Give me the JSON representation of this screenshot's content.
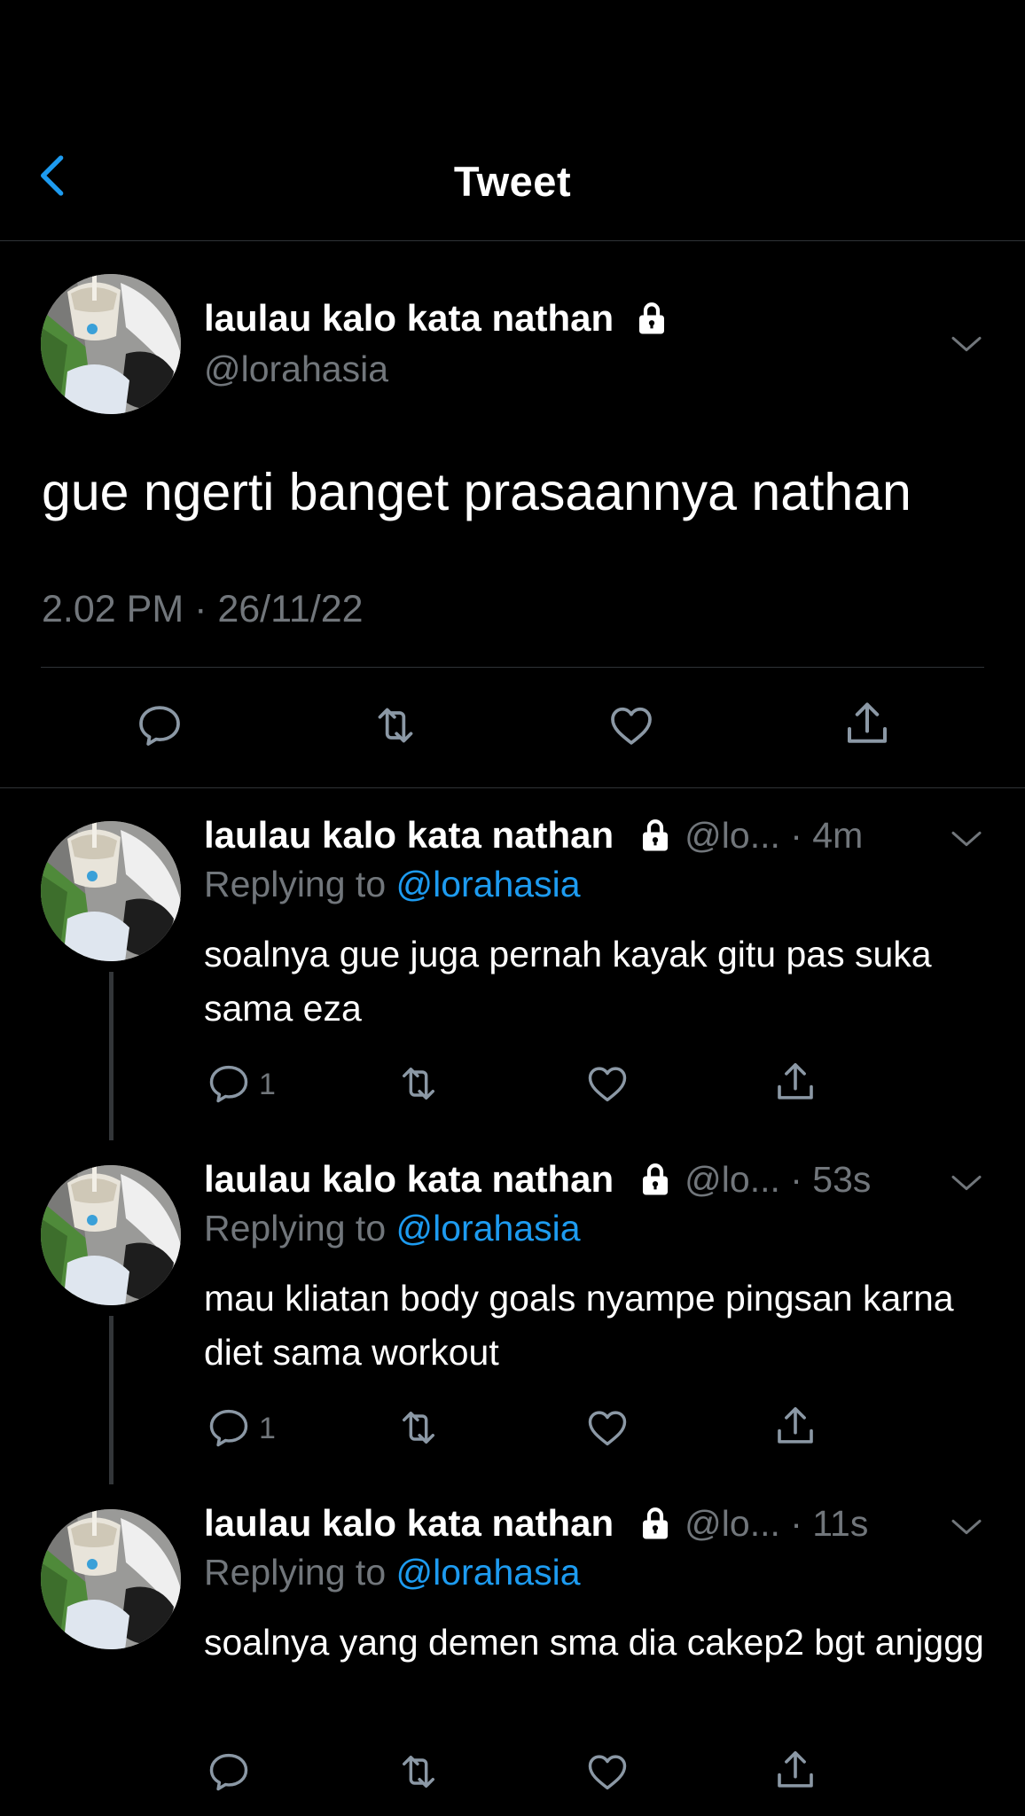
{
  "header": {
    "title": "Tweet",
    "back_icon": "chevron-left-icon"
  },
  "colors": {
    "background": "#000000",
    "text": "#ffffff",
    "muted": "#71767b",
    "accent": "#1d9bf0",
    "divider": "#2f3336"
  },
  "main_tweet": {
    "display_name": "laulau kalo kata nathan",
    "handle": "@lorahasia",
    "text": "gue ngerti banget prasaannya nathan",
    "timestamp": "2.02 PM · 26/11/22",
    "actions": [
      "reply-icon",
      "retweet-icon",
      "like-icon",
      "share-icon"
    ]
  },
  "replies": [
    {
      "display_name": "laulau kalo kata nathan",
      "handle_meta": "@lo... · 4m",
      "replying_prefix": "Replying to ",
      "replying_to": "@lorahasia",
      "text": "soalnya gue juga pernah kayak gitu pas suka sama eza",
      "reply_count": "1"
    },
    {
      "display_name": "laulau kalo kata nathan",
      "handle_meta": "@lo... · 53s",
      "replying_prefix": "Replying to ",
      "replying_to": "@lorahasia",
      "text": "mau kliatan body goals nyampe pingsan karna diet sama workout",
      "reply_count": "1"
    },
    {
      "display_name": "laulau kalo kata nathan",
      "handle_meta": "@lo... · 11s",
      "replying_prefix": "Replying to ",
      "replying_to": "@lorahasia",
      "text": "soalnya yang demen sma dia cakep2 bgt anjggg",
      "reply_count": ""
    }
  ]
}
